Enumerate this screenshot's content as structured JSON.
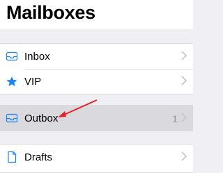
{
  "header": {
    "title": "Mailboxes"
  },
  "mailboxes": [
    {
      "label": "Inbox",
      "icon": "inbox-tray-icon"
    },
    {
      "label": "VIP",
      "icon": "star-icon"
    },
    {
      "label": "Outbox",
      "icon": "inbox-tray-icon",
      "count": "1",
      "selected": true
    },
    {
      "label": "Drafts",
      "icon": "document-icon"
    }
  ],
  "colors": {
    "accent": "#1a82fb",
    "annotation_arrow": "#e3222a",
    "chevron": "#c7c7cc"
  }
}
